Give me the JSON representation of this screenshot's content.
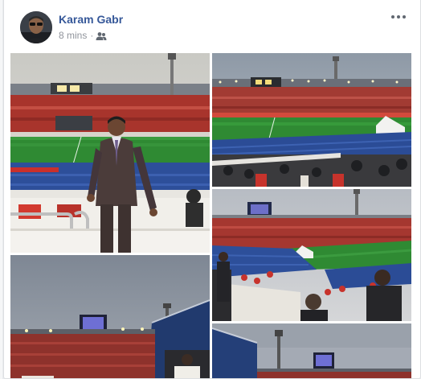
{
  "post": {
    "author_name": "Karam Gabr",
    "timestamp": "8 mins",
    "separator": "·",
    "audience_icon": "friends-icon",
    "more_icon": "more-options-icon"
  },
  "photos": [
    {
      "name": "stadium-photo-man-standing"
    },
    {
      "name": "stadium-photo-pitch-view"
    },
    {
      "name": "stadium-photo-crowd-seats"
    },
    {
      "name": "stadium-photo-dusk-sky"
    },
    {
      "name": "stadium-photo-scoreboard"
    }
  ],
  "colors": {
    "author_link": "#365899",
    "meta_text": "#90949c",
    "pitch_green": "#2f8a33",
    "crowd_red": "#a8342c",
    "seat_blue": "#2d4f9a"
  }
}
